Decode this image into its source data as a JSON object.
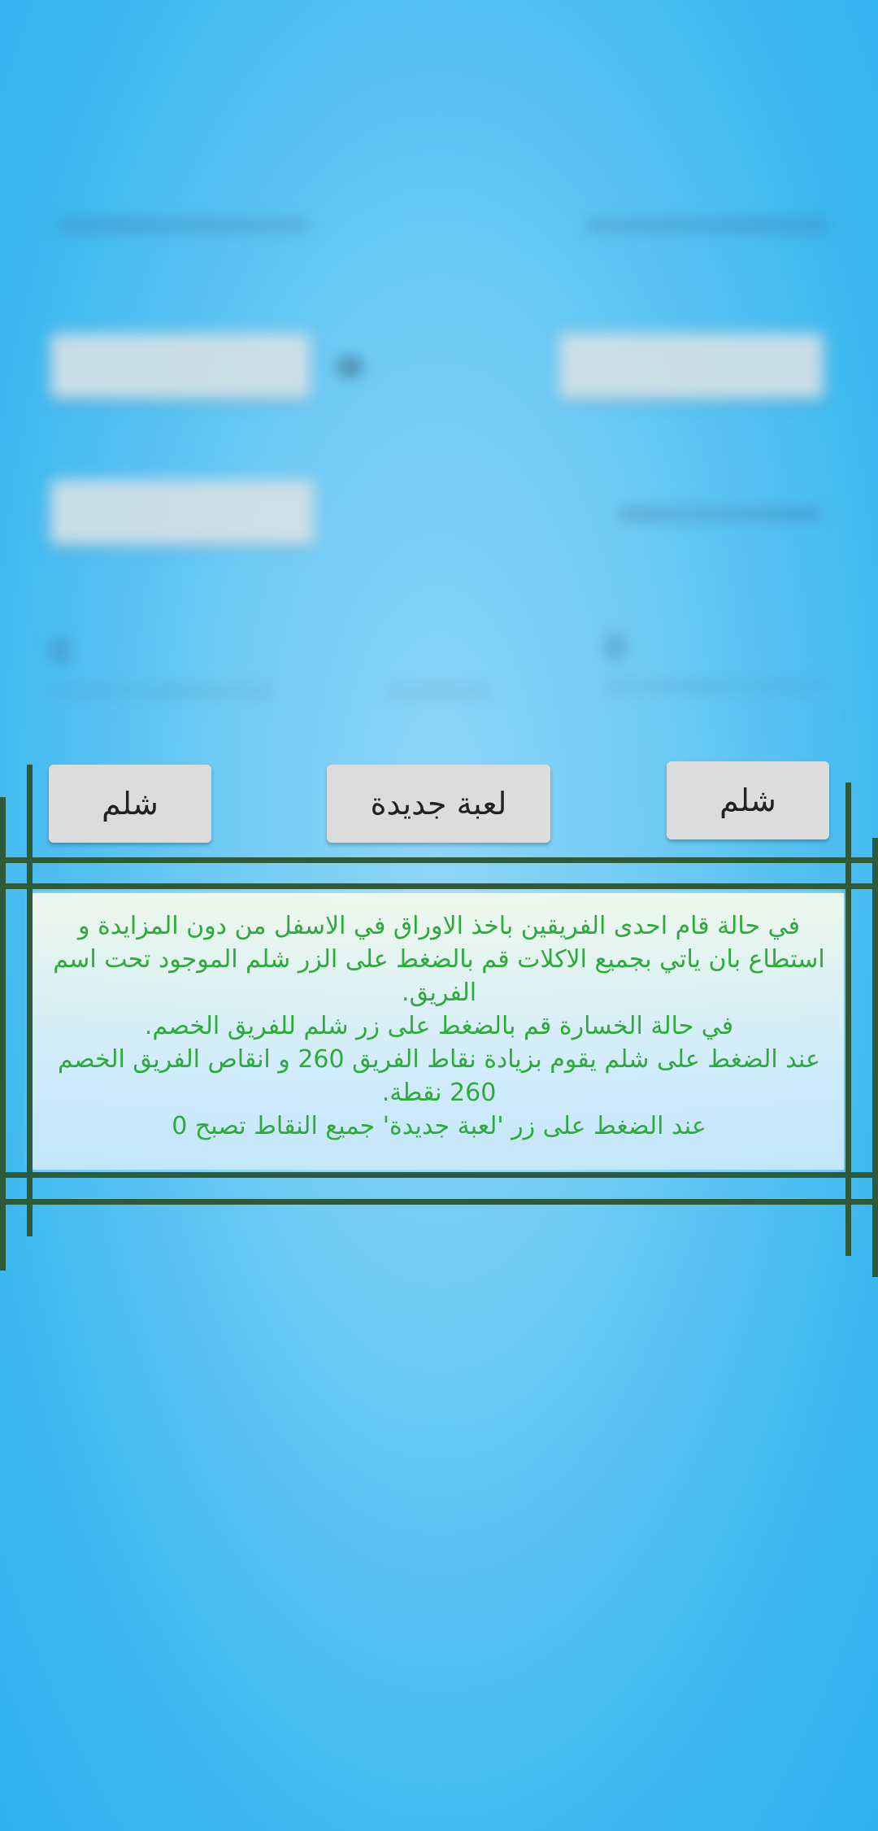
{
  "buttons": {
    "shelem_left": "شلم",
    "new_game": "لعبة جديدة",
    "shelem_right": "شلم"
  },
  "info": {
    "lines": [
      "في حالة قام احدى الفريقين باخذ الاوراق في الاسفل من دون المزايدة و استطاع بان ياتي بجميع الاكلات قم بالضغط على الزر شلم الموجود تحت اسم الفريق.",
      "في حالة الخسارة قم بالضغط على زر شلم للفريق الخصم.",
      "عند الضغط على شلم يقوم بزيادة نقاط الفريق 260 و انقاص الفريق الخصم 260 نقطة.",
      "عند الضغط على زر 'لعبة جديدة' جميع النقاط تصبح 0"
    ]
  },
  "colors": {
    "info_text": "#2eaa3c",
    "frame": "#2e5a3a",
    "background": "#3db8f0"
  }
}
